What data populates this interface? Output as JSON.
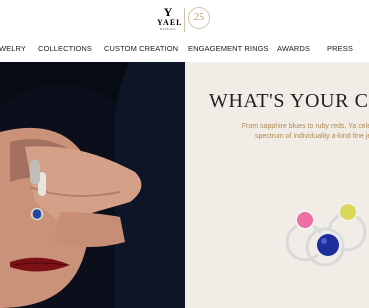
{
  "brand": {
    "logo_initial": "Y",
    "logo_name": "YAEL",
    "logo_sub": "DESIGNS",
    "anniversary": "25"
  },
  "nav": {
    "items": [
      "JEWELRY",
      "COLLECTIONS",
      "CUSTOM CREATION",
      "ENGAGEMENT RINGS",
      "AWARDS",
      "PRESS"
    ]
  },
  "hero": {
    "headline": "WHAT'S YOUR C",
    "description": "From sapphire blues to ruby reds, Ya celebrates the spectrum of individuality a-kind fine jewelry."
  },
  "colors": {
    "photo_bg": "#0e1526",
    "panel_bg": "#f1ede6",
    "accent_gold": "#b08a4f"
  }
}
